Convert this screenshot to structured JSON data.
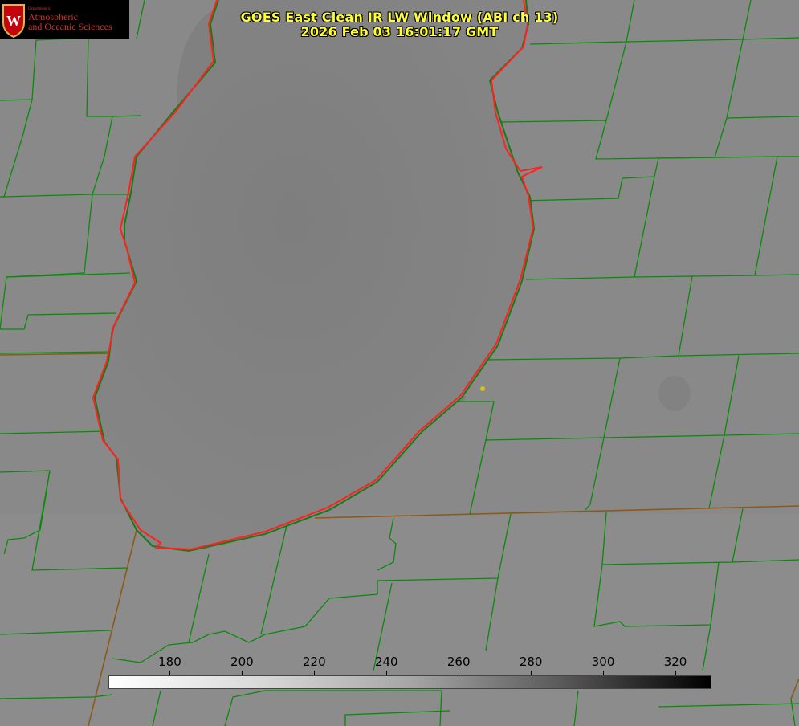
{
  "title": {
    "line1": "GOES East Clean IR LW Window (ABI ch 13)",
    "line2": "2026 Feb 03 16:01:17 GMT"
  },
  "logo": {
    "department": "Department of",
    "name_line1": "Atmospheric",
    "name_line2": "and Oceanic Sciences",
    "icon": "uw-crest-icon"
  },
  "colorbar": {
    "ticks": [
      "180",
      "200",
      "220",
      "240",
      "260",
      "280",
      "300",
      "320"
    ],
    "min": 163,
    "max": 330,
    "colors": [
      "#ffffff",
      "#000000"
    ]
  },
  "colors": {
    "county_lines": "#0a8a0a",
    "lake_outline": "#ff2020",
    "title_text": "#ffff33",
    "marker": "#d4c21a"
  }
}
